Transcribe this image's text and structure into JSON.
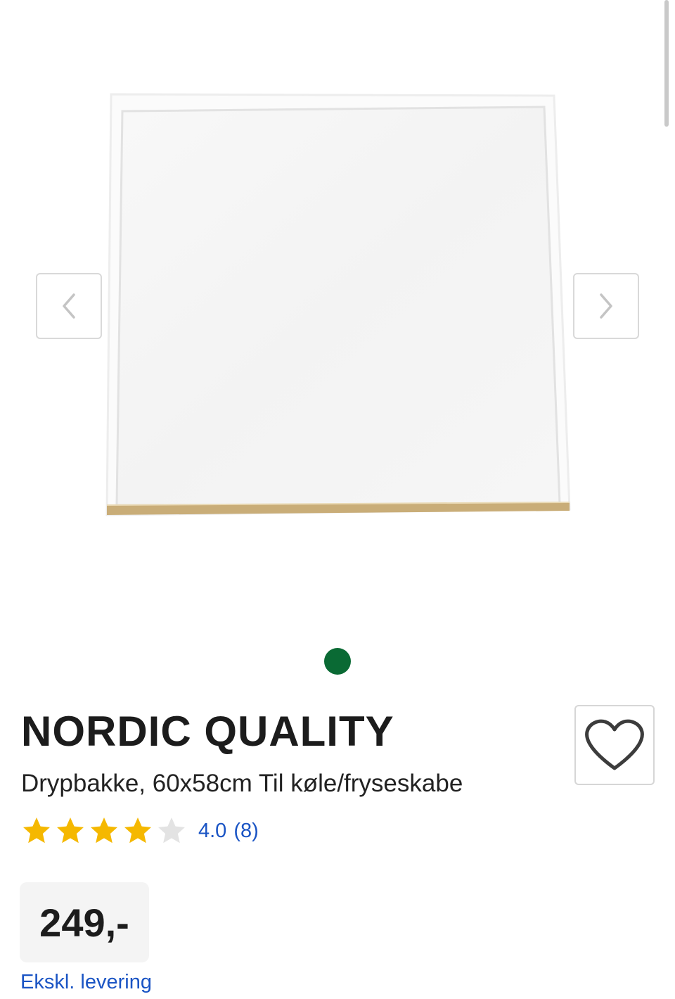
{
  "gallery": {
    "image_alt": "Drypbakke",
    "prev_icon": "chevron-left-icon",
    "next_icon": "chevron-right-icon",
    "active_dot_color": "#0a6a34"
  },
  "product": {
    "brand": "NORDIC QUALITY",
    "description": "Drypbakke, 60x58cm Til køle/fryseskabe",
    "favorite_icon": "heart-icon"
  },
  "rating": {
    "stars": 4,
    "max_stars": 5,
    "value": "4.0",
    "count": "(8)"
  },
  "price": {
    "amount": "249,-",
    "delivery_note": "Ekskl. levering"
  },
  "colors": {
    "link": "#1a54c4",
    "star_filled": "#f5b800",
    "star_empty": "#e3e3e3",
    "border": "#d9d9d9"
  }
}
